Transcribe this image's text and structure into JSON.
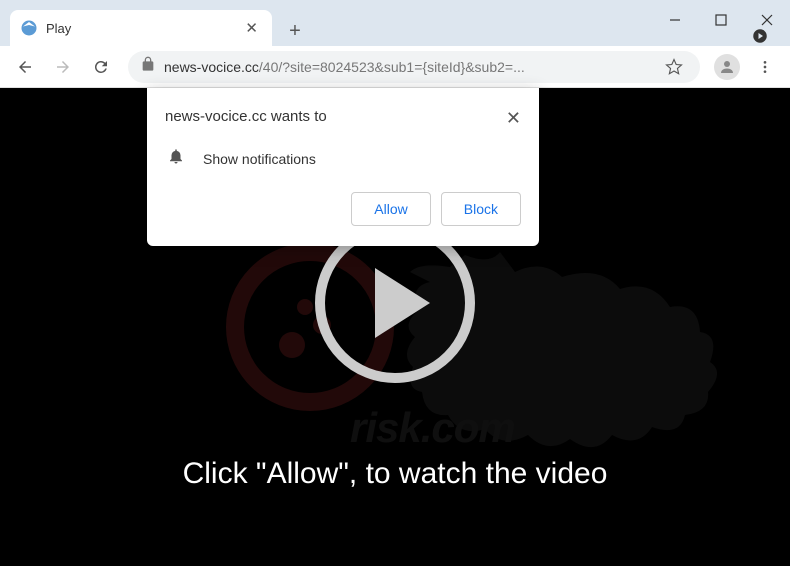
{
  "window": {
    "minimize": "—",
    "maximize": "☐",
    "close": "✕"
  },
  "tabStrip": {
    "tab": {
      "title": "Play",
      "closeLabel": "✕"
    },
    "newTabLabel": "+"
  },
  "toolbar": {
    "url": {
      "domain": "news-vocice.cc",
      "path": "/40/?site=8024523&sub1={siteId}&sub2=..."
    }
  },
  "permissionPopup": {
    "title": "news-vocice.cc wants to",
    "bodyText": "Show notifications",
    "allowLabel": "Allow",
    "blockLabel": "Block",
    "closeLabel": "✕"
  },
  "page": {
    "instruction": "Click \"Allow\", to watch the video",
    "watermark": "risk.com"
  }
}
